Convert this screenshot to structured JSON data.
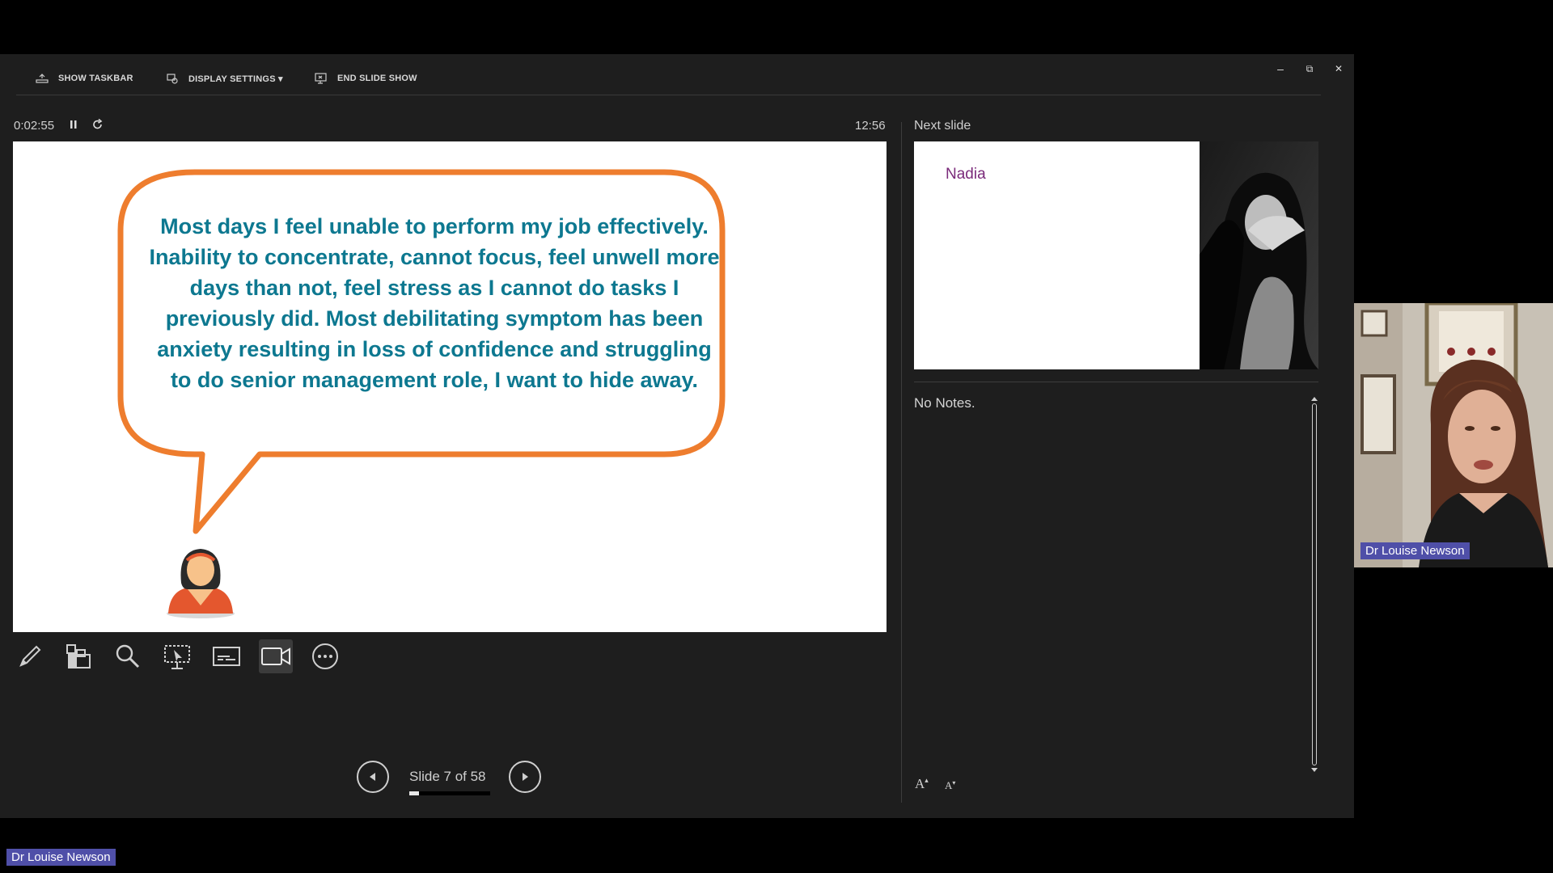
{
  "toolbar": {
    "show_taskbar": "SHOW TASKBAR",
    "display_settings": "DISPLAY SETTINGS ▾",
    "end_slide_show": "END SLIDE SHOW"
  },
  "window_controls": {
    "minimize": "–",
    "restore": "⧉",
    "close": "✕"
  },
  "timer": {
    "elapsed": "0:02:55",
    "clock": "12:56"
  },
  "current_slide": {
    "quote": "Most days I feel unable to perform my job effectively. Inability to concentrate, cannot focus, feel unwell more days than not, feel stress as I cannot do tasks I previously did. Most debilitating symptom has been anxiety resulting in loss of confidence and struggling to do senior management role, I want to hide away.",
    "bubble_color": "#ee7d2e",
    "text_color": "#0d7890"
  },
  "tools": [
    "pen-icon",
    "slide-sorter-icon",
    "zoom-icon",
    "pointer-screen-icon",
    "subtitles-icon",
    "camera-icon",
    "more-options-icon"
  ],
  "navigation": {
    "counter": "Slide 7 of 58",
    "current": 7,
    "total": 58
  },
  "next_slide": {
    "label": "Next slide",
    "title": "Nadia"
  },
  "notes": {
    "text": "No Notes."
  },
  "font_controls": {
    "increase": "A",
    "decrease": "A"
  },
  "participants": {
    "video_name": "Dr Louise Newson",
    "presenter_name": "Dr Louise Newson",
    "tag_color": "#4f4fa8"
  }
}
